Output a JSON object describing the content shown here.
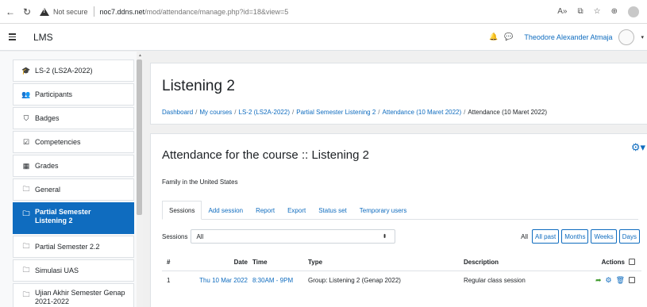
{
  "browser": {
    "back_icon": "back-arrow-icon",
    "reload_icon": "reload-icon",
    "security_label": "Not secure",
    "url_host": "noc7.ddns.net",
    "url_path": "/mod/attendance/manage.php?id=18&view=5",
    "toolbar_icons": [
      "read-aloud-icon",
      "extensions-icon",
      "favorites-icon",
      "collections-icon",
      "profile-icon"
    ]
  },
  "navbar": {
    "brand": "LMS",
    "user_name": "Theodore Alexander Atmaja"
  },
  "sidebar": {
    "items": [
      {
        "label": "LS-2 (LS2A-2022)",
        "icon": "graduation-cap-icon",
        "glyph": "🎓"
      },
      {
        "label": "Participants",
        "icon": "users-icon",
        "glyph": "👥"
      },
      {
        "label": "Badges",
        "icon": "shield-icon",
        "glyph": "⛉"
      },
      {
        "label": "Competencies",
        "icon": "check-square-icon",
        "glyph": "☑"
      },
      {
        "label": "Grades",
        "icon": "table-icon",
        "glyph": "▦"
      },
      {
        "label": "General",
        "icon": "folder-icon",
        "glyph": "🗀"
      },
      {
        "label": "Partial Semester Listening 2",
        "icon": "folder-icon",
        "glyph": "🗀"
      },
      {
        "label": "Partial Semester 2.2",
        "icon": "folder-icon",
        "glyph": "🗀"
      },
      {
        "label": "Simulasi UAS",
        "icon": "folder-icon",
        "glyph": "🗀"
      },
      {
        "label": "Ujian Akhir Semester Genap 2021-2022",
        "icon": "folder-icon",
        "glyph": "🗀"
      }
    ],
    "active_index": 6
  },
  "page": {
    "title": "Listening 2",
    "breadcrumb": [
      "Dashboard",
      "My courses",
      "LS-2 (LS2A-2022)",
      "Partial Semester Listening 2",
      "Attendance (10 Maret 2022)",
      "Attendance (10 Maret 2022)"
    ],
    "breadcrumb_sep": "/"
  },
  "attendance": {
    "heading": "Attendance for the course :: Listening 2",
    "subtext": "Family in the United States",
    "tabs": [
      "Sessions",
      "Add session",
      "Report",
      "Export",
      "Status set",
      "Temporary users"
    ],
    "active_tab": 0,
    "filter_label": "Sessions",
    "filter_value": "All",
    "period_static": "All",
    "period_buttons": [
      "All past",
      "Months",
      "Weeks",
      "Days"
    ],
    "table": {
      "headers": {
        "num": "#",
        "date": "Date",
        "time": "Time",
        "type": "Type",
        "description": "Description",
        "actions": "Actions"
      },
      "rows": [
        {
          "num": "1",
          "date": "Thu 10 Mar 2022",
          "time": "8:30AM - 9PM",
          "type": "Group: Listening 2 (Genap 2022)",
          "description": "Regular class session"
        }
      ]
    }
  }
}
